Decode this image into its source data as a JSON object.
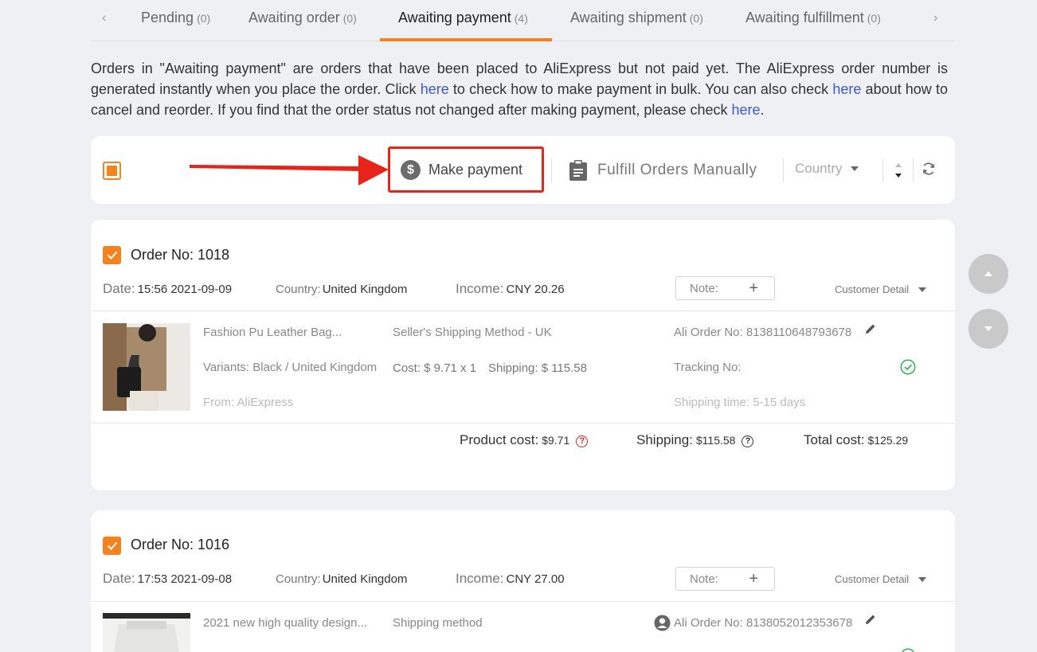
{
  "tabs": [
    {
      "label": "Pending",
      "count": "(0)"
    },
    {
      "label": "Awaiting order",
      "count": "(0)"
    },
    {
      "label": "Awaiting payment",
      "count": "(4)"
    },
    {
      "label": "Awaiting shipment",
      "count": "(0)"
    },
    {
      "label": "Awaiting fulfillment",
      "count": "(0)"
    }
  ],
  "active_tab": "Awaiting payment",
  "intro": {
    "part1": "Orders in \"Awaiting payment\" are orders that have been placed to AliExpress but not paid yet. The AliExpress order number is generated instantly when you place the order. Click ",
    "link1": "here",
    "part2": " to check how to make payment in bulk. You can also check ",
    "link2": "here",
    "part3": " about how to cancel and reorder. If you find that the order status not changed after making payment, please check ",
    "link3": "here",
    "part4": "."
  },
  "toolbar": {
    "make_payment": "Make payment",
    "fulfill": "Fulfill Orders Manually",
    "country": "Country"
  },
  "orders": [
    {
      "order_no": "Order No: 1018",
      "date_label": "Date:",
      "date": "15:56 2021-09-09",
      "country_label": "Country:",
      "country": "United Kingdom",
      "income_label": "Income:",
      "income": "CNY 20.26",
      "note": "Note:",
      "note_plus": "+",
      "customer_detail": "Customer Detail",
      "product_title": "Fashion Pu Leather Bag...",
      "variants": "Variants: Black / United Kingdom",
      "from": "From: AliExpress",
      "shipping_method": "Seller's Shipping Method - UK",
      "cost": "Cost: $ 9.71 x 1",
      "shipping_cost": "Shipping: $ 115.58",
      "ali_order": "Ali Order No: 8138110648793678",
      "tracking": "Tracking No:",
      "shipping_time": "Shipping time: 5-15 days",
      "product_cost_label": "Product cost:",
      "product_cost": "$9.71",
      "shipping_label": "Shipping:",
      "shipping": "$115.58",
      "total_label": "Total cost:",
      "total": "$125.29"
    },
    {
      "order_no": "Order No: 1016",
      "date_label": "Date:",
      "date": "17:53 2021-09-08",
      "country_label": "Country:",
      "country": "United Kingdom",
      "income_label": "Income:",
      "income": "CNY 27.00",
      "note": "Note:",
      "note_plus": "+",
      "customer_detail": "Customer Detail",
      "product_title": "2021 new high quality design...",
      "shipping_method": "Shipping method",
      "ali_order": "Ali Order No: 8138052012353678"
    }
  ],
  "colors": {
    "accent": "#f5821f",
    "link": "#3b57d6",
    "highlight": "#e8231a",
    "ok": "#2db34a"
  }
}
